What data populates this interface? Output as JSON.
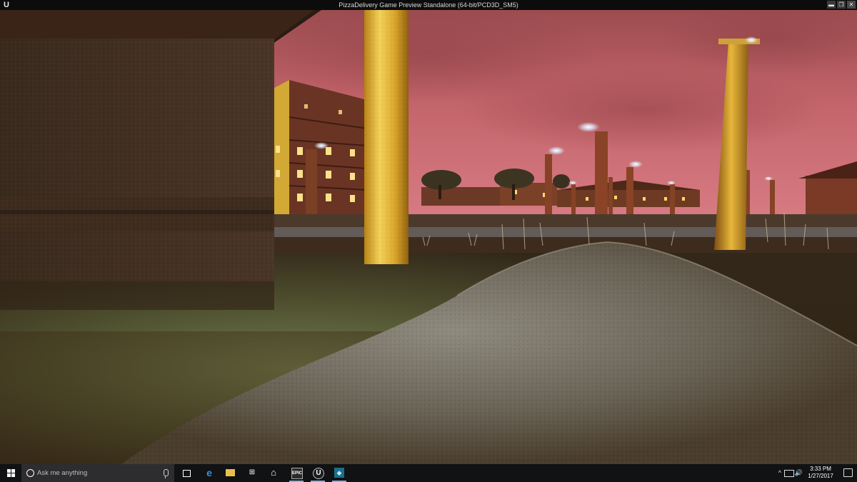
{
  "window": {
    "title": "PizzaDelivery Game Preview Standalone (64-bit/PCD3D_SM5)",
    "logo_glyph": "U",
    "controls": {
      "minimize": "▬",
      "maximize": "❐",
      "close": "✕"
    }
  },
  "scene": {
    "description_icons": [
      "building",
      "pillar",
      "street-lamp",
      "tree",
      "gravel-mound",
      "grass"
    ]
  },
  "taskbar": {
    "search_placeholder": "Ask me anything",
    "apps": [
      {
        "name": "task-view",
        "glyph": "▭"
      },
      {
        "name": "edge",
        "glyph": "e"
      },
      {
        "name": "file-explorer",
        "glyph": "▬"
      },
      {
        "name": "store",
        "glyph": "⊞"
      },
      {
        "name": "home",
        "glyph": "⌂"
      },
      {
        "name": "epic-games",
        "glyph": "EPIC"
      },
      {
        "name": "unreal-engine",
        "glyph": "U"
      },
      {
        "name": "unreal-project",
        "glyph": "◆"
      }
    ],
    "tray": {
      "chevron": "^",
      "volume": "🔊",
      "time": "3:33 PM",
      "date": "1/27/2017"
    }
  }
}
